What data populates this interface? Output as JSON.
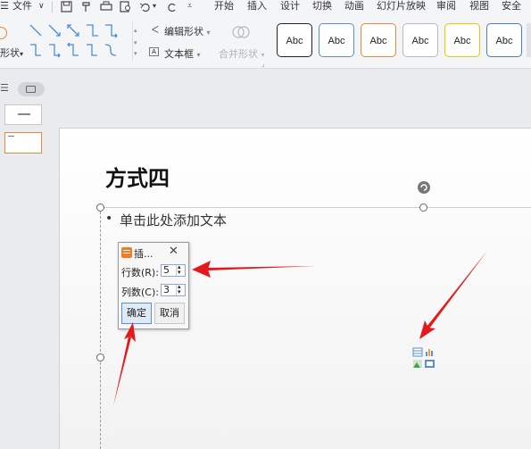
{
  "menu": {
    "file_label": "文件",
    "tabs": [
      "开始",
      "插入",
      "设计",
      "切换",
      "动画",
      "幻灯片放映",
      "审阅",
      "视图",
      "安全"
    ]
  },
  "ribbon": {
    "shape_label_partial": "形状",
    "edit_shape_label": "编辑形状",
    "text_box_label": "文本框",
    "merge_shapes_label": "合并形状",
    "style_samples": [
      {
        "label": "Abc",
        "border": "#222222"
      },
      {
        "label": "Abc",
        "border": "#5b8fd4"
      },
      {
        "label": "Abc",
        "border": "#e8883a"
      },
      {
        "label": "Abc",
        "border": "#b9b9b9"
      },
      {
        "label": "Abc",
        "border": "#f0c20c"
      },
      {
        "label": "Abc",
        "border": "#4a7cc6"
      }
    ]
  },
  "slide": {
    "title": "方式四",
    "placeholder": "单击此处添加文本"
  },
  "dialog": {
    "title": "插...",
    "rows_label": "行数(R):",
    "rows_value": "5",
    "cols_label": "列数(C):",
    "cols_value": "3",
    "ok_label": "确定",
    "cancel_label": "取消"
  },
  "colors": {
    "arrow": "#e3191c",
    "accent": "#4a8fd6",
    "dialog_icon": "#f07c2a"
  }
}
